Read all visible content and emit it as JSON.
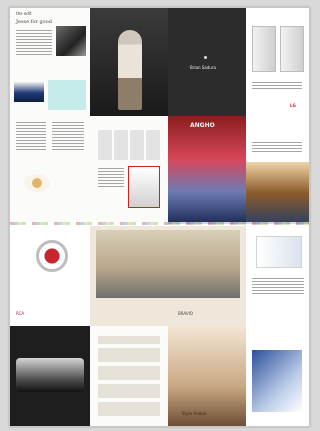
{
  "spread_1": {
    "page_1": {
      "title": "Jesse for good",
      "section": "the edit"
    },
    "page_2": {
      "caption": ""
    },
    "page_3": {
      "brand": "Brian Sadura"
    },
    "page_4": {
      "caption": "LG"
    }
  },
  "spread_2": {
    "page_3": {
      "headline": "ANGHO"
    }
  },
  "spread_3": {
    "page_1": {
      "caption": "RCA"
    },
    "page_3": {
      "footer": "BRAVIO"
    }
  },
  "spread_4": {
    "page_3": {
      "title": "Style Arabia"
    }
  },
  "colors": {
    "sheet": "#ffffff",
    "background": "#d9d9d9",
    "accent_red": "#c7262e",
    "accent_blue": "#2d4f9b"
  }
}
